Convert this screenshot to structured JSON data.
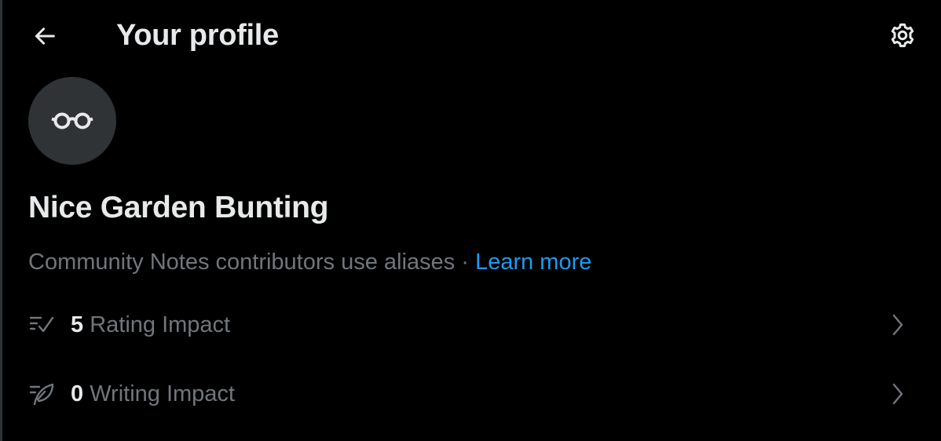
{
  "header": {
    "title": "Your profile",
    "back_icon": "arrow-left-icon",
    "settings_icon": "gear-icon"
  },
  "profile": {
    "avatar_icon": "glasses-icon",
    "alias_name": "Nice Garden Bunting",
    "alias_note": "Community Notes contributors use aliases ·",
    "learn_more": "Learn more"
  },
  "stats": [
    {
      "icon": "rating-check-icon",
      "value": "5",
      "label": "Rating Impact"
    },
    {
      "icon": "writing-feather-icon",
      "value": "0",
      "label": "Writing Impact"
    }
  ],
  "colors": {
    "background": "#000000",
    "primary_text": "#e7e9ea",
    "secondary_text": "#71767b",
    "link": "#1d9bf0",
    "avatar_bg": "#2f3336"
  }
}
